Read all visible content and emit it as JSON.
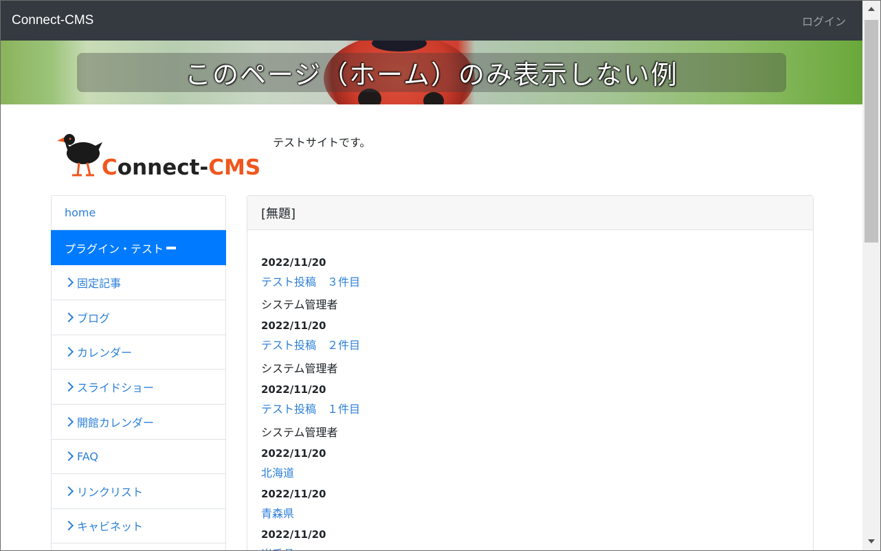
{
  "navbar": {
    "brand": "Connect-CMS",
    "login": "ログイン"
  },
  "hero": {
    "title": "このページ（ホーム）のみ表示しない例"
  },
  "site": {
    "description": "テストサイトです。",
    "logo_text": "Connect-CMS"
  },
  "sidebar": {
    "items": [
      {
        "label": "home"
      },
      {
        "label": "プラグイン・テスト",
        "active": true
      },
      {
        "label": "固定記事"
      },
      {
        "label": "ブログ"
      },
      {
        "label": "カレンダー"
      },
      {
        "label": "スライドショー"
      },
      {
        "label": "開館カレンダー"
      },
      {
        "label": "FAQ"
      },
      {
        "label": "リンクリスト"
      },
      {
        "label": "キャビネット"
      }
    ]
  },
  "panel": {
    "title": "[無題]",
    "entries": [
      {
        "date": "2022/11/20",
        "title": "テスト投稿　３件目",
        "author": "システム管理者"
      },
      {
        "date": "2022/11/20",
        "title": "テスト投稿　２件目",
        "author": "システム管理者"
      },
      {
        "date": "2022/11/20",
        "title": "テスト投稿　１件目",
        "author": "システム管理者"
      },
      {
        "date": "2022/11/20",
        "title": "北海道"
      },
      {
        "date": "2022/11/20",
        "title": "青森県"
      },
      {
        "date": "2022/11/20",
        "title": "岩手県"
      }
    ]
  },
  "colors": {
    "navbar": "#343a40",
    "accent": "#007bff",
    "link": "#2b7fd8",
    "logo_orange": "#f0561d"
  }
}
